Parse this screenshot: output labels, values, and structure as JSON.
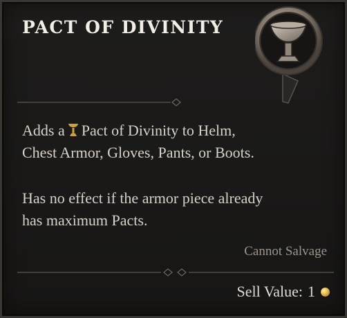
{
  "item": {
    "title": "PACT OF DIVINITY",
    "icon": "chalice-ring-icon"
  },
  "description": {
    "line1_prefix": "Adds a",
    "line1_suffix": "Pact of Divinity to Helm,",
    "line2": "Chest Armor, Gloves, Pants, or Boots.",
    "line3": "Has no effect if the armor piece already",
    "line4": "has maximum Pacts.",
    "inline_icon": "divinity-chalice-icon"
  },
  "footer": {
    "salvage": "Cannot Salvage",
    "sell_label": "Sell Value:",
    "sell_value": "1",
    "currency_icon": "gold-coin-icon"
  },
  "colors": {
    "background": "#1b1a19",
    "title": "#f2eee6",
    "text": "#d8d2c8",
    "muted": "#9c958b",
    "chalice": "#c9a23c",
    "gold": "#e6b84a"
  }
}
